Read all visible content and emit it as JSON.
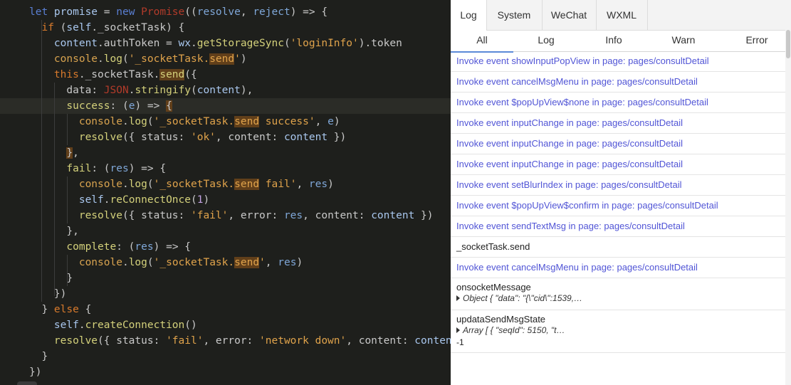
{
  "editor": {
    "lines": [
      [
        {
          "t": "let ",
          "c": "keyword"
        },
        {
          "t": "promise",
          "c": "var"
        },
        {
          "t": " = ",
          "c": "punct"
        },
        {
          "t": "new ",
          "c": "keyword"
        },
        {
          "t": "Promise",
          "c": "class"
        },
        {
          "t": "((",
          "c": "punct"
        },
        {
          "t": "resolve",
          "c": "param"
        },
        {
          "t": ", ",
          "c": "punct"
        },
        {
          "t": "reject",
          "c": "param"
        },
        {
          "t": ") => {",
          "c": "punct"
        }
      ],
      [
        {
          "t": "  if ",
          "c": "kw2"
        },
        {
          "t": "(",
          "c": "punct"
        },
        {
          "t": "self",
          "c": "var"
        },
        {
          "t": "._socketTask) {",
          "c": "punct"
        }
      ],
      [
        {
          "t": "    content",
          "c": "var"
        },
        {
          "t": ".authToken = ",
          "c": "punct"
        },
        {
          "t": "wx",
          "c": "var"
        },
        {
          "t": ".",
          "c": "punct"
        },
        {
          "t": "getStorageSync",
          "c": "func"
        },
        {
          "t": "(",
          "c": "punct"
        },
        {
          "t": "'loginInfo'",
          "c": "str"
        },
        {
          "t": ").token",
          "c": "punct"
        }
      ],
      [
        {
          "t": "    console",
          "c": "builtin"
        },
        {
          "t": ".",
          "c": "punct"
        },
        {
          "t": "log",
          "c": "func"
        },
        {
          "t": "(",
          "c": "punct"
        },
        {
          "t": "'_socketTask.",
          "c": "str"
        },
        {
          "t": "send",
          "c": "str",
          "hl": true
        },
        {
          "t": "'",
          "c": "str"
        },
        {
          "t": ")",
          "c": "punct"
        }
      ],
      [
        {
          "t": "    this",
          "c": "kw2"
        },
        {
          "t": "._socketTask.",
          "c": "punct"
        },
        {
          "t": "send",
          "c": "func",
          "hl": true
        },
        {
          "t": "({",
          "c": "punct"
        }
      ],
      [
        {
          "t": "      data",
          "c": "prop"
        },
        {
          "t": ": ",
          "c": "punct"
        },
        {
          "t": "JSON",
          "c": "class"
        },
        {
          "t": ".",
          "c": "punct"
        },
        {
          "t": "stringify",
          "c": "func"
        },
        {
          "t": "(",
          "c": "punct"
        },
        {
          "t": "content",
          "c": "var"
        },
        {
          "t": "),",
          "c": "punct"
        }
      ],
      [
        {
          "t": "      success",
          "c": "func"
        },
        {
          "t": ": (",
          "c": "punct"
        },
        {
          "t": "e",
          "c": "param"
        },
        {
          "t": ") => ",
          "c": "punct"
        },
        {
          "t": "{",
          "c": "punct",
          "hl": true
        }
      ],
      [
        {
          "t": "        console",
          "c": "builtin"
        },
        {
          "t": ".",
          "c": "punct"
        },
        {
          "t": "log",
          "c": "func"
        },
        {
          "t": "(",
          "c": "punct"
        },
        {
          "t": "'_socketTask.",
          "c": "str"
        },
        {
          "t": "send",
          "c": "str",
          "hl": true
        },
        {
          "t": " success'",
          "c": "str"
        },
        {
          "t": ", ",
          "c": "punct"
        },
        {
          "t": "e",
          "c": "param"
        },
        {
          "t": ")",
          "c": "punct"
        }
      ],
      [
        {
          "t": "        resolve",
          "c": "func"
        },
        {
          "t": "({ status: ",
          "c": "punct"
        },
        {
          "t": "'ok'",
          "c": "str"
        },
        {
          "t": ", content: ",
          "c": "punct"
        },
        {
          "t": "content",
          "c": "var"
        },
        {
          "t": " })",
          "c": "punct"
        }
      ],
      [
        {
          "t": "      ",
          "c": "punct"
        },
        {
          "t": "}",
          "c": "punct",
          "hl": true
        },
        {
          "t": ",",
          "c": "punct"
        }
      ],
      [
        {
          "t": "      fail",
          "c": "func"
        },
        {
          "t": ": (",
          "c": "punct"
        },
        {
          "t": "res",
          "c": "param"
        },
        {
          "t": ") => {",
          "c": "punct"
        }
      ],
      [
        {
          "t": "        console",
          "c": "builtin"
        },
        {
          "t": ".",
          "c": "punct"
        },
        {
          "t": "log",
          "c": "func"
        },
        {
          "t": "(",
          "c": "punct"
        },
        {
          "t": "'_socketTask.",
          "c": "str"
        },
        {
          "t": "send",
          "c": "str",
          "hl": true
        },
        {
          "t": " fail'",
          "c": "str"
        },
        {
          "t": ", ",
          "c": "punct"
        },
        {
          "t": "res",
          "c": "param"
        },
        {
          "t": ")",
          "c": "punct"
        }
      ],
      [
        {
          "t": "        self",
          "c": "var"
        },
        {
          "t": ".",
          "c": "punct"
        },
        {
          "t": "reConnectOnce",
          "c": "func"
        },
        {
          "t": "(",
          "c": "punct"
        },
        {
          "t": "1",
          "c": "num"
        },
        {
          "t": ")",
          "c": "punct"
        }
      ],
      [
        {
          "t": "        resolve",
          "c": "func"
        },
        {
          "t": "({ status: ",
          "c": "punct"
        },
        {
          "t": "'fail'",
          "c": "str"
        },
        {
          "t": ", error: ",
          "c": "punct"
        },
        {
          "t": "res",
          "c": "param"
        },
        {
          "t": ", content: ",
          "c": "punct"
        },
        {
          "t": "content",
          "c": "var"
        },
        {
          "t": " })",
          "c": "punct"
        }
      ],
      [
        {
          "t": "      },",
          "c": "punct"
        }
      ],
      [
        {
          "t": "      complete",
          "c": "func"
        },
        {
          "t": ": (",
          "c": "punct"
        },
        {
          "t": "res",
          "c": "param"
        },
        {
          "t": ") => {",
          "c": "punct"
        }
      ],
      [
        {
          "t": "        console",
          "c": "builtin"
        },
        {
          "t": ".",
          "c": "punct"
        },
        {
          "t": "log",
          "c": "func"
        },
        {
          "t": "(",
          "c": "punct"
        },
        {
          "t": "'_socketTask.",
          "c": "str"
        },
        {
          "t": "send",
          "c": "str",
          "hl": true
        },
        {
          "t": "'",
          "c": "str"
        },
        {
          "t": ", ",
          "c": "punct"
        },
        {
          "t": "res",
          "c": "param"
        },
        {
          "t": ")",
          "c": "punct"
        }
      ],
      [
        {
          "t": "      }",
          "c": "punct"
        }
      ],
      [
        {
          "t": "    })",
          "c": "punct"
        }
      ],
      [
        {
          "t": "  } ",
          "c": "punct"
        },
        {
          "t": "else",
          "c": "kw2"
        },
        {
          "t": " {",
          "c": "punct"
        }
      ],
      [
        {
          "t": "    self",
          "c": "var"
        },
        {
          "t": ".",
          "c": "punct"
        },
        {
          "t": "createConnection",
          "c": "func"
        },
        {
          "t": "()",
          "c": "punct"
        }
      ],
      [
        {
          "t": "    resolve",
          "c": "func"
        },
        {
          "t": "({ status: ",
          "c": "punct"
        },
        {
          "t": "'fail'",
          "c": "str"
        },
        {
          "t": ", error: ",
          "c": "punct"
        },
        {
          "t": "'network down'",
          "c": "str"
        },
        {
          "t": ", content: ",
          "c": "punct"
        },
        {
          "t": "content",
          "c": "var"
        },
        {
          "t": " })",
          "c": "punct"
        }
      ],
      [
        {
          "t": "  }",
          "c": "punct"
        }
      ],
      [
        {
          "t": "})",
          "c": "punct"
        }
      ]
    ],
    "current_line": 6
  },
  "console": {
    "tabs": [
      "Log",
      "System",
      "WeChat",
      "WXML"
    ],
    "active_tab": 0,
    "filters": [
      "All",
      "Log",
      "Info",
      "Warn",
      "Error"
    ],
    "active_filter": 0,
    "entries": [
      {
        "kind": "event",
        "text": "Invoke event showInputPopView in page: pages/consultDetail"
      },
      {
        "kind": "event",
        "text": "Invoke event cancelMsgMenu in page: pages/consultDetail"
      },
      {
        "kind": "event",
        "text": "Invoke event $popUpView$none in page: pages/consultDetail"
      },
      {
        "kind": "event",
        "text": "Invoke event inputChange in page: pages/consultDetail"
      },
      {
        "kind": "event",
        "text": "Invoke event inputChange in page: pages/consultDetail"
      },
      {
        "kind": "event",
        "text": "Invoke event inputChange in page: pages/consultDetail"
      },
      {
        "kind": "event",
        "text": "Invoke event setBlurIndex in page: pages/consultDetail"
      },
      {
        "kind": "event",
        "text": "Invoke event $popUpView$confirm in page: pages/consultDetail"
      },
      {
        "kind": "event",
        "text": "Invoke event sendTextMsg in page: pages/consultDetail"
      },
      {
        "kind": "plain",
        "text": "_socketTask.send"
      },
      {
        "kind": "event",
        "text": "Invoke event cancelMsgMenu in page: pages/consultDetail"
      },
      {
        "kind": "object",
        "text": "onsocketMessage",
        "detail": "Object { \"data\": \"{\\\"cid\\\":1539,…"
      },
      {
        "kind": "object",
        "text": "updataSendMsgState",
        "detail": "Array [ { \"seqId\": 5150, \"t…",
        "extra": "-1"
      }
    ]
  }
}
